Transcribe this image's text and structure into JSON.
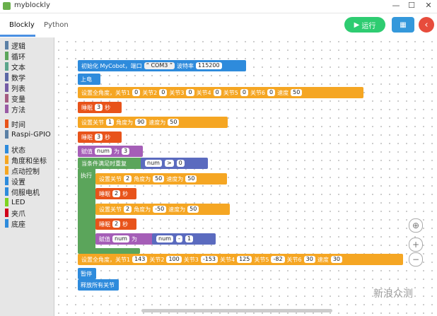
{
  "window": {
    "title": "myblockly",
    "minimize": "—",
    "maximize": "☐",
    "close": "✕"
  },
  "tabs": [
    {
      "label": "Blockly"
    },
    {
      "label": "Python"
    }
  ],
  "toolbar": {
    "run_label": "运行",
    "run_icon": "play-icon",
    "grid_icon": "grid-icon",
    "back_icon": "back-icon"
  },
  "toolbox": {
    "categories": [
      {
        "label": "逻辑",
        "color": "#5b80a5"
      },
      {
        "label": "循环",
        "color": "#5ba55b"
      },
      {
        "label": "文本",
        "color": "#5ba58c"
      },
      {
        "label": "数学",
        "color": "#5b67a5"
      },
      {
        "label": "列表",
        "color": "#745ba5"
      },
      {
        "label": "变量",
        "color": "#a55b80"
      },
      {
        "label": "方法",
        "color": "#995ba5"
      },
      {
        "label": "时间",
        "color": "#e8531a"
      },
      {
        "label": "Raspi-GPIO",
        "color": "#5b80a5"
      },
      {
        "label": "状态",
        "color": "#2e8bdc"
      },
      {
        "label": "角度和坐标",
        "color": "#f5a623"
      },
      {
        "label": "点动控制",
        "color": "#f5a623"
      },
      {
        "label": "设置",
        "color": "#2e8bdc"
      },
      {
        "label": "伺服电机",
        "color": "#2e8bdc"
      },
      {
        "label": "LED",
        "color": "#7ed321"
      },
      {
        "label": "夹爪",
        "color": "#d0021b"
      },
      {
        "label": "底座",
        "color": "#2e8bdc"
      }
    ]
  },
  "blocks": {
    "init": {
      "text": "初始化 MyCobot，端口",
      "port": "COM3",
      "baud_label": "波特率",
      "baud": "115200"
    },
    "power_on": "上电",
    "set_all": {
      "label": "设置全角度，关节1",
      "j1": "0",
      "j2l": "关节2",
      "j2": "0",
      "j3l": "关节3",
      "j3": "0",
      "j4l": "关节4",
      "j4": "0",
      "j5l": "关节5",
      "j5": "0",
      "j6l": "关节6",
      "j6": "0",
      "speed_label": "速度",
      "speed": "50"
    },
    "sleep1": {
      "label": "睡眠",
      "value": "3",
      "unit": "秒"
    },
    "set_joint1": {
      "label": "设置关节",
      "joint": "1",
      "angle_label": "角度为",
      "angle": "90",
      "speed_label": "速度为",
      "speed": "50"
    },
    "sleep2": {
      "label": "睡眠",
      "value": "3",
      "unit": "秒"
    },
    "assign1": {
      "label": "赋值",
      "var": "num",
      "to": "为",
      "value": "3"
    },
    "while": {
      "label": "当条件满足时重复",
      "var": "num",
      "op": ">",
      "value": "0",
      "do": "执行"
    },
    "inner_set1": {
      "label": "设置关节",
      "joint": "2",
      "angle_label": "角度为",
      "angle": "50",
      "speed_label": "速度为",
      "speed": "50"
    },
    "inner_sleep1": {
      "label": "睡眠",
      "value": "2",
      "unit": "秒"
    },
    "inner_set2": {
      "label": "设置关节",
      "joint": "2",
      "angle_label": "角度为",
      "angle": "-50",
      "speed_label": "速度为",
      "speed": "50"
    },
    "inner_sleep2": {
      "label": "睡眠",
      "value": "2",
      "unit": "秒"
    },
    "inner_assign": {
      "label": "赋值",
      "var": "num",
      "to": "为",
      "var2": "num",
      "op": "-",
      "value": "1"
    },
    "set_all2": {
      "label": "设置全角度，关节1",
      "j1": "143",
      "j2l": "关节2",
      "j2": "100",
      "j3l": "关节3",
      "j3": "-153",
      "j4l": "关节4",
      "j4": "125",
      "j5l": "关节5",
      "j5": "-82",
      "j6l": "关节6",
      "j6": "30",
      "speed_label": "速度",
      "speed": "30"
    },
    "pause": "暂停",
    "release": "释放所有关节"
  },
  "watermark": "新浪众测"
}
